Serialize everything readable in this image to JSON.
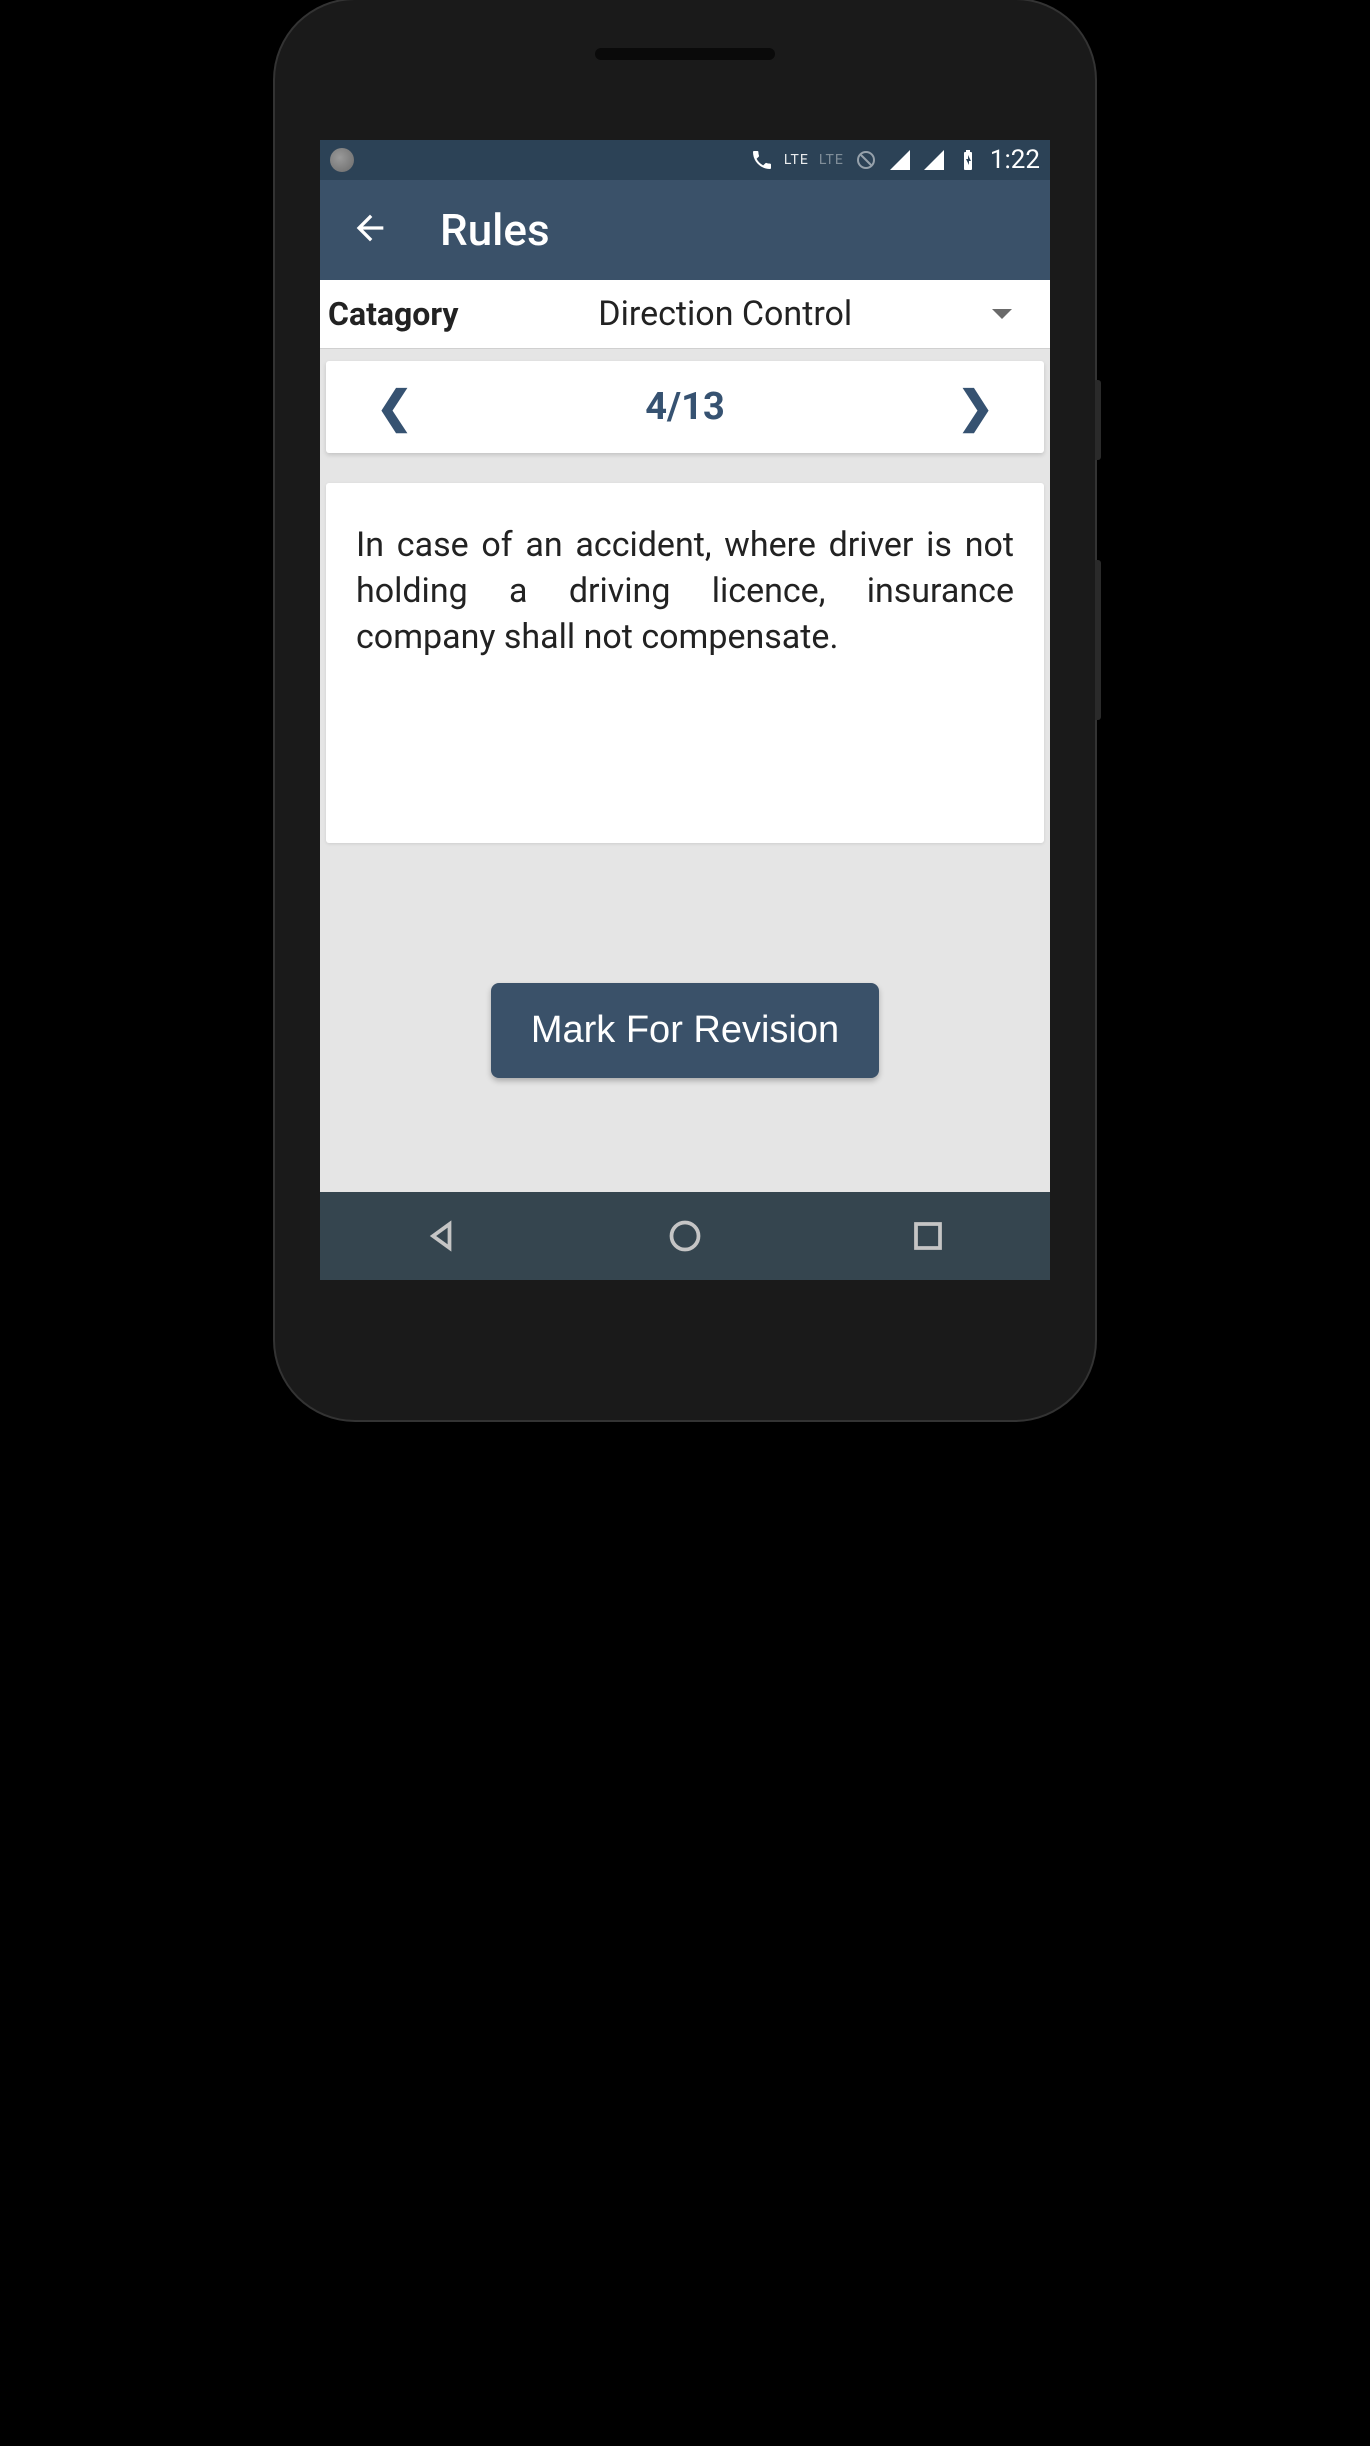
{
  "status": {
    "lte1": "LTE",
    "lte2": "LTE",
    "time": "1:22"
  },
  "appbar": {
    "title": "Rules"
  },
  "category": {
    "label": "Catagory",
    "selected": "Direction Control"
  },
  "pager": {
    "counter": "4/13"
  },
  "rule": {
    "text": "In case of an accident, where driver is not holding a driving licence, insurance company shall not compensate."
  },
  "actions": {
    "mark": "Mark For Revision"
  }
}
